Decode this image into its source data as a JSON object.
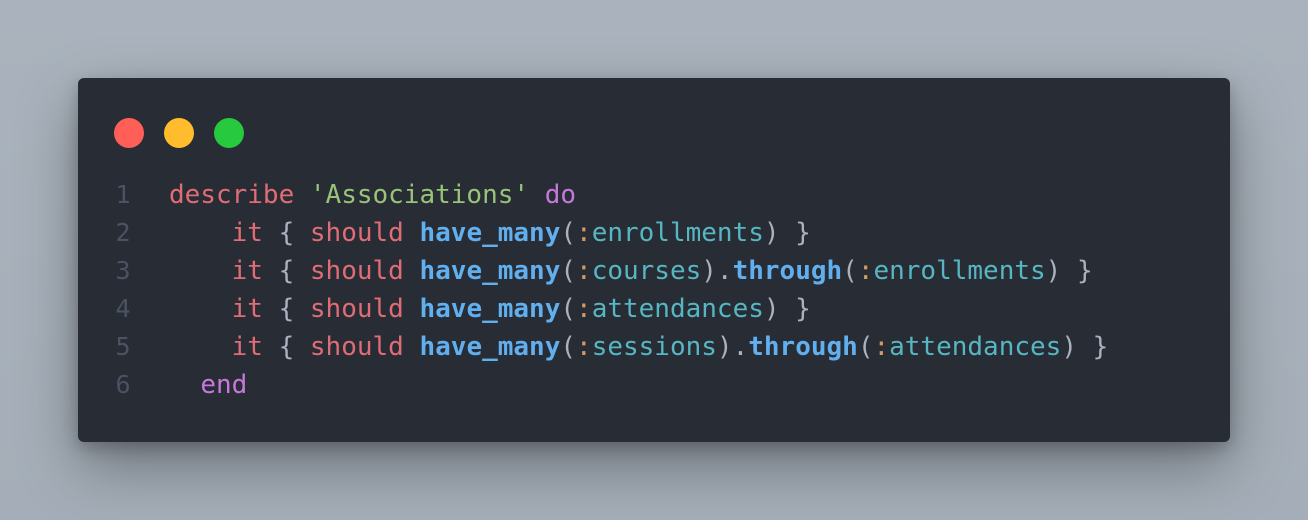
{
  "window": {
    "controls": [
      {
        "name": "close",
        "color": "#ff5f56"
      },
      {
        "name": "minimize",
        "color": "#ffbd2e"
      },
      {
        "name": "maximize",
        "color": "#27c93f"
      }
    ]
  },
  "code": {
    "lines": [
      {
        "number": "1",
        "indent": "",
        "tokens": [
          {
            "text": "describe",
            "cls": "t-kw-red"
          },
          {
            "text": " ",
            "cls": "t-plain"
          },
          {
            "text": "'Associations'",
            "cls": "t-str"
          },
          {
            "text": " ",
            "cls": "t-plain"
          },
          {
            "text": "do",
            "cls": "t-kw-purple"
          }
        ]
      },
      {
        "number": "2",
        "indent": "    ",
        "tokens": [
          {
            "text": "it",
            "cls": "t-kw-red"
          },
          {
            "text": " { ",
            "cls": "t-plain"
          },
          {
            "text": "should",
            "cls": "t-kw-red"
          },
          {
            "text": " ",
            "cls": "t-plain"
          },
          {
            "text": "have_many",
            "cls": "t-fn"
          },
          {
            "text": "(",
            "cls": "t-plain"
          },
          {
            "text": ":",
            "cls": "t-colon"
          },
          {
            "text": "enrollments",
            "cls": "t-sym"
          },
          {
            "text": ") }",
            "cls": "t-plain"
          }
        ]
      },
      {
        "number": "3",
        "indent": "    ",
        "tokens": [
          {
            "text": "it",
            "cls": "t-kw-red"
          },
          {
            "text": " { ",
            "cls": "t-plain"
          },
          {
            "text": "should",
            "cls": "t-kw-red"
          },
          {
            "text": " ",
            "cls": "t-plain"
          },
          {
            "text": "have_many",
            "cls": "t-fn"
          },
          {
            "text": "(",
            "cls": "t-plain"
          },
          {
            "text": ":",
            "cls": "t-colon"
          },
          {
            "text": "courses",
            "cls": "t-sym"
          },
          {
            "text": ").",
            "cls": "t-plain"
          },
          {
            "text": "through",
            "cls": "t-fn"
          },
          {
            "text": "(",
            "cls": "t-plain"
          },
          {
            "text": ":",
            "cls": "t-colon"
          },
          {
            "text": "enrollments",
            "cls": "t-sym"
          },
          {
            "text": ") }",
            "cls": "t-plain"
          }
        ]
      },
      {
        "number": "4",
        "indent": "    ",
        "tokens": [
          {
            "text": "it",
            "cls": "t-kw-red"
          },
          {
            "text": " { ",
            "cls": "t-plain"
          },
          {
            "text": "should",
            "cls": "t-kw-red"
          },
          {
            "text": " ",
            "cls": "t-plain"
          },
          {
            "text": "have_many",
            "cls": "t-fn"
          },
          {
            "text": "(",
            "cls": "t-plain"
          },
          {
            "text": ":",
            "cls": "t-colon"
          },
          {
            "text": "attendances",
            "cls": "t-sym"
          },
          {
            "text": ") }",
            "cls": "t-plain"
          }
        ]
      },
      {
        "number": "5",
        "indent": "    ",
        "tokens": [
          {
            "text": "it",
            "cls": "t-kw-red"
          },
          {
            "text": " { ",
            "cls": "t-plain"
          },
          {
            "text": "should",
            "cls": "t-kw-red"
          },
          {
            "text": " ",
            "cls": "t-plain"
          },
          {
            "text": "have_many",
            "cls": "t-fn"
          },
          {
            "text": "(",
            "cls": "t-plain"
          },
          {
            "text": ":",
            "cls": "t-colon"
          },
          {
            "text": "sessions",
            "cls": "t-sym"
          },
          {
            "text": ").",
            "cls": "t-plain"
          },
          {
            "text": "through",
            "cls": "t-fn"
          },
          {
            "text": "(",
            "cls": "t-plain"
          },
          {
            "text": ":",
            "cls": "t-colon"
          },
          {
            "text": "attendances",
            "cls": "t-sym"
          },
          {
            "text": ") }",
            "cls": "t-plain"
          }
        ]
      },
      {
        "number": "6",
        "indent": "  ",
        "tokens": [
          {
            "text": "end",
            "cls": "t-kw-purple"
          }
        ]
      }
    ]
  }
}
